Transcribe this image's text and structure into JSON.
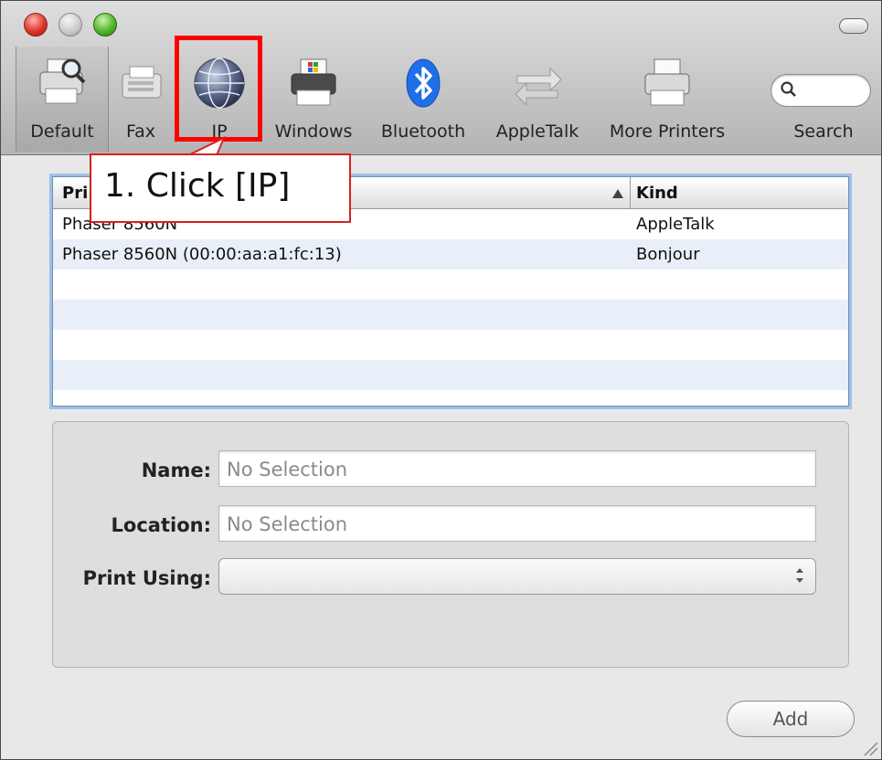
{
  "toolbar": {
    "items": [
      {
        "label": "Default",
        "icon": "printer-magnifier-icon"
      },
      {
        "label": "Fax",
        "icon": "fax-icon"
      },
      {
        "label": "IP",
        "icon": "globe-icon"
      },
      {
        "label": "Windows",
        "icon": "windows-printer-icon"
      },
      {
        "label": "Bluetooth",
        "icon": "bluetooth-icon"
      },
      {
        "label": "AppleTalk",
        "icon": "appletalk-arrows-icon"
      },
      {
        "label": "More Printers",
        "icon": "printer-icon"
      },
      {
        "label": "Search",
        "icon": "search-icon"
      }
    ]
  },
  "printer_list": {
    "columns": [
      "Pri",
      "Kind"
    ],
    "rows": [
      {
        "name": "Phaser 8560N",
        "kind": "AppleTalk"
      },
      {
        "name": "Phaser 8560N (00:00:aa:a1:fc:13)",
        "kind": "Bonjour"
      }
    ]
  },
  "details": {
    "name_label": "Name:",
    "name_value": "No Selection",
    "location_label": "Location:",
    "location_value": "No Selection",
    "print_using_label": "Print Using:",
    "print_using_value": ""
  },
  "add_button": "Add",
  "annotation": {
    "text": "1. Click [IP]",
    "color": "#ff0000"
  }
}
